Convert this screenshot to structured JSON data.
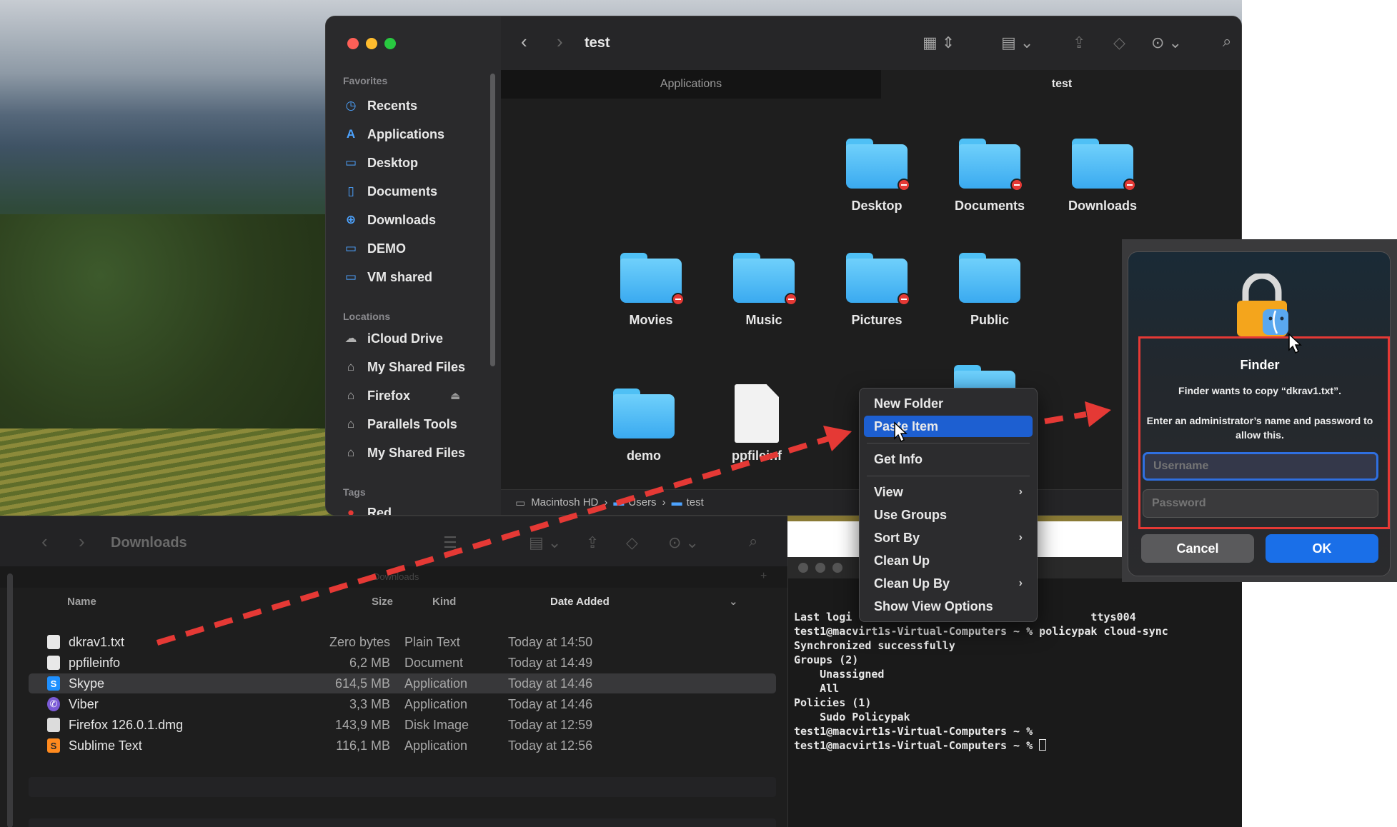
{
  "main_window": {
    "title": "test",
    "sidebar": {
      "favorites_heading": "Favorites",
      "favorites": [
        "Recents",
        "Applications",
        "Desktop",
        "Documents",
        "Downloads",
        "DEMO",
        "VM shared"
      ],
      "locations_heading": "Locations",
      "locations": [
        "iCloud Drive",
        "My Shared Files",
        "Firefox",
        "Parallels Tools",
        "My Shared Files"
      ],
      "tags_heading": "Tags",
      "tags": [
        "Red"
      ]
    },
    "tabs": [
      "Applications",
      "test"
    ],
    "folders": [
      "Desktop",
      "Documents",
      "Downloads",
      "Movies",
      "Music",
      "Pictures",
      "Public",
      "demo"
    ],
    "file": "ppfileinf",
    "path_bar": [
      "Macintosh HD",
      "Users",
      "test"
    ]
  },
  "context_menu": {
    "items": [
      "New Folder",
      "Paste Item",
      "Get Info",
      "View",
      "Use Groups",
      "Sort By",
      "Clean Up",
      "Clean Up By",
      "Show View Options"
    ],
    "highlighted": "Paste Item"
  },
  "downloads_window": {
    "title": "Downloads",
    "tab": "Downloads",
    "columns": [
      "Name",
      "Size",
      "Kind",
      "Date Added"
    ],
    "rows": [
      {
        "name": "dkrav1.txt",
        "size": "Zero bytes",
        "kind": "Plain Text",
        "date": "Today at 14:50"
      },
      {
        "name": "ppfileinfo",
        "size": "6,2 MB",
        "kind": "Document",
        "date": "Today at 14:49"
      },
      {
        "name": "Skype",
        "size": "614,5 MB",
        "kind": "Application",
        "date": "Today at 14:46"
      },
      {
        "name": "Viber",
        "size": "3,3 MB",
        "kind": "Application",
        "date": "Today at 14:46"
      },
      {
        "name": "Firefox 126.0.1.dmg",
        "size": "143,9 MB",
        "kind": "Disk Image",
        "date": "Today at 12:59"
      },
      {
        "name": "Sublime Text",
        "size": "116,1 MB",
        "kind": "Application",
        "date": "Today at 12:56"
      }
    ]
  },
  "terminal": {
    "lines": [
      "Last logi                                     ttys004",
      "test1@macvirt1s-Virtual-Computers ~ % policypak cloud-sync",
      "Synchronized successfully",
      "Groups (2)",
      "    Unassigned",
      "    All",
      "Policies (1)",
      "    Sudo Policypak",
      "test1@macvirt1s-Virtual-Computers ~ %",
      "test1@macvirt1s-Virtual-Computers ~ % "
    ]
  },
  "auth_dialog": {
    "title": "Finder",
    "message": "Finder wants to copy “dkrav1.txt”.",
    "instruction": "Enter an administrator’s name and password to allow this.",
    "username_placeholder": "Username",
    "password_placeholder": "Password",
    "cancel_label": "Cancel",
    "ok_label": "OK"
  },
  "colors": {
    "accent": "#1d5fd1",
    "annotation": "#e53935",
    "folder": "#4fc0f5"
  }
}
